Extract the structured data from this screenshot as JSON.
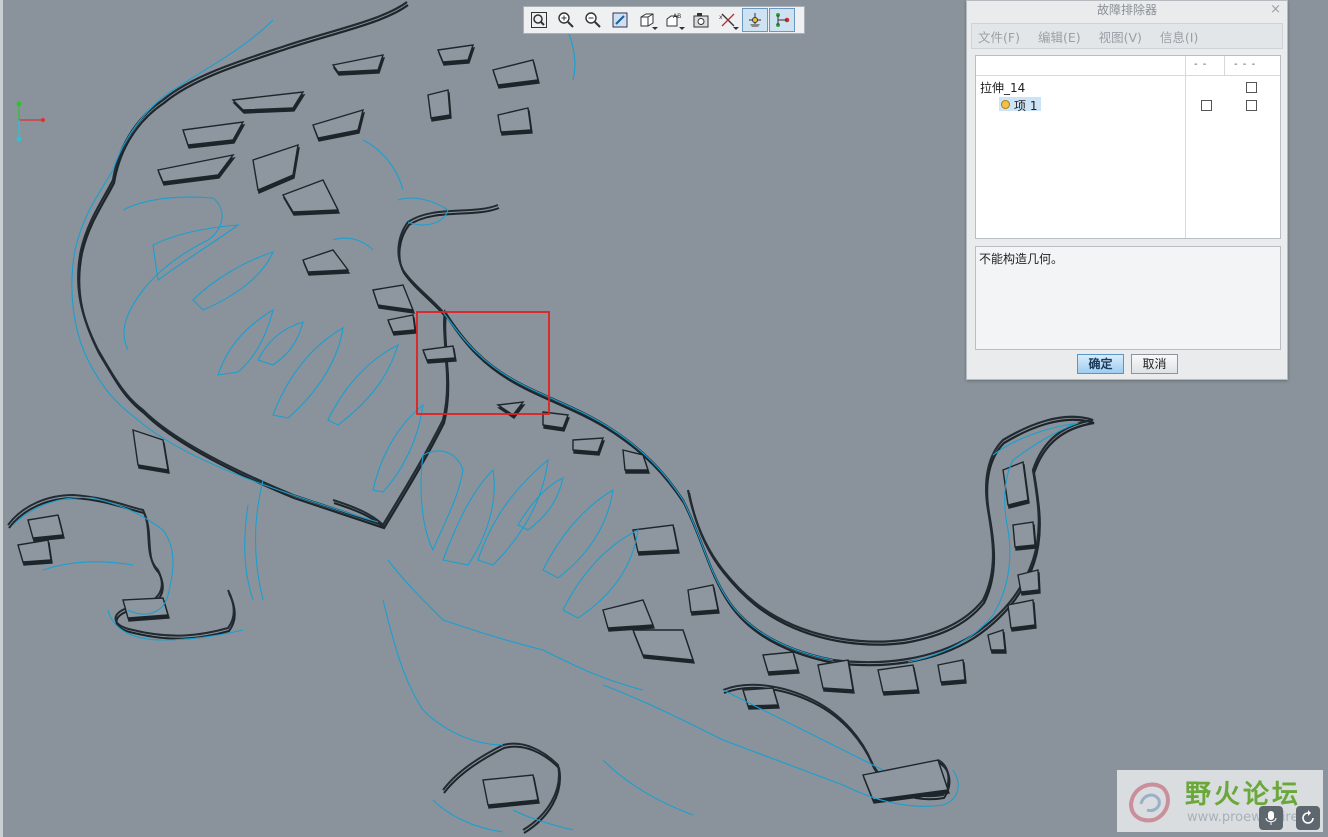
{
  "toolbar": {
    "items": [
      {
        "icon": "zoom-fit-icon",
        "active": false
      },
      {
        "icon": "zoom-in-icon",
        "active": false
      },
      {
        "icon": "zoom-out-icon",
        "active": false
      },
      {
        "icon": "repaint-icon",
        "active": false
      },
      {
        "icon": "display-style-icon",
        "active": false
      },
      {
        "icon": "saved-views-icon",
        "active": false
      },
      {
        "icon": "view-manager-icon",
        "active": false
      },
      {
        "icon": "datum-display-icon",
        "active": false
      },
      {
        "icon": "spin-center-icon",
        "active": true
      },
      {
        "icon": "annotation-display-icon",
        "active": true
      }
    ]
  },
  "dialog": {
    "title": "故障排除器",
    "close_symbol": "×",
    "menu": [
      "文件(F)",
      "编辑(E)",
      "视图(V)",
      "信息(I)"
    ],
    "columns": [
      "- -",
      "- - -"
    ],
    "tree": {
      "parent_label": "拉伸_14",
      "child_label": "项 1"
    },
    "message": "不能构造几何。",
    "ok_label": "确定",
    "cancel_label": "取消"
  },
  "watermark": {
    "text": "野火论坛",
    "url": "www.proewildfire.cn"
  },
  "colors": {
    "background": "#8a939b",
    "curve": "#1a9fd0",
    "highlight_box": "#e02020",
    "accent": "#9fcdf0"
  }
}
